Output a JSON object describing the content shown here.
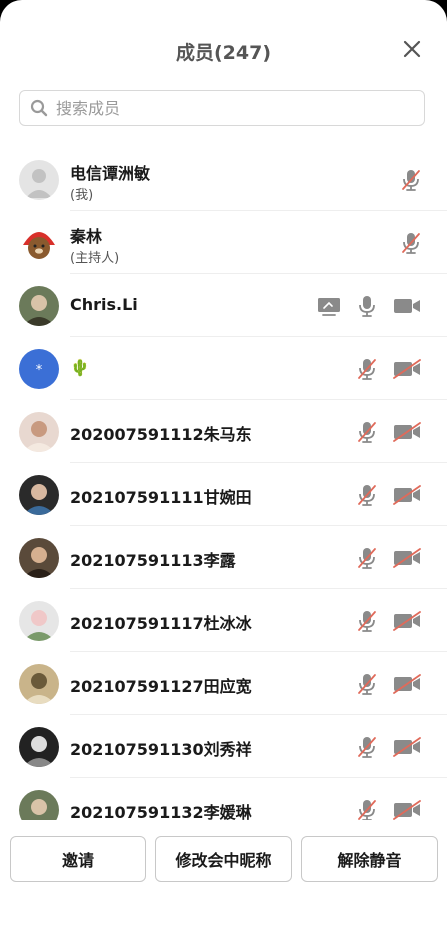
{
  "header": {
    "title": "成员(247)"
  },
  "search": {
    "placeholder": "搜索成员"
  },
  "members": [
    {
      "name": "电信谭洲敏",
      "sub": "(我)",
      "avatar": "default-avatar",
      "show_mic": true,
      "mic_muted": true,
      "show_screen": false,
      "show_camera": false,
      "camera_off": false
    },
    {
      "name": "秦林",
      "sub": "(主持人)",
      "avatar": "bear-avatar",
      "show_mic": true,
      "mic_muted": true,
      "show_screen": false,
      "show_camera": false,
      "camera_off": false
    },
    {
      "name": "Chris.Li",
      "sub": "",
      "avatar": "photo-avatar",
      "show_mic": true,
      "mic_muted": false,
      "show_screen": true,
      "show_camera": true,
      "camera_off": false
    },
    {
      "name": "🌵",
      "sub": "",
      "avatar": "star-avatar",
      "show_mic": true,
      "mic_muted": true,
      "show_screen": false,
      "show_camera": true,
      "camera_off": true
    },
    {
      "name": "202007591112朱马东",
      "sub": "",
      "avatar": "photo-avatar",
      "show_mic": true,
      "mic_muted": true,
      "show_screen": false,
      "show_camera": true,
      "camera_off": true
    },
    {
      "name": "202107591111甘婉田",
      "sub": "",
      "avatar": "photo-avatar",
      "show_mic": true,
      "mic_muted": true,
      "show_screen": false,
      "show_camera": true,
      "camera_off": true
    },
    {
      "name": "202107591113李露",
      "sub": "",
      "avatar": "photo-avatar",
      "show_mic": true,
      "mic_muted": true,
      "show_screen": false,
      "show_camera": true,
      "camera_off": true
    },
    {
      "name": "202107591117杜冰冰",
      "sub": "",
      "avatar": "photo-avatar",
      "show_mic": true,
      "mic_muted": true,
      "show_screen": false,
      "show_camera": true,
      "camera_off": true
    },
    {
      "name": "202107591127田应宽",
      "sub": "",
      "avatar": "photo-avatar",
      "show_mic": true,
      "mic_muted": true,
      "show_screen": false,
      "show_camera": true,
      "camera_off": true
    },
    {
      "name": "202107591130刘秀祥",
      "sub": "",
      "avatar": "photo-avatar",
      "show_mic": true,
      "mic_muted": true,
      "show_screen": false,
      "show_camera": true,
      "camera_off": true
    },
    {
      "name": "202107591132李媛琳",
      "sub": "",
      "avatar": "photo-avatar",
      "show_mic": true,
      "mic_muted": true,
      "show_screen": false,
      "show_camera": true,
      "camera_off": true
    }
  ],
  "footer": {
    "invite_label": "邀请",
    "rename_label": "修改会中昵称",
    "unmute_label": "解除静音"
  },
  "colors": {
    "icon_gray": "#8a8a8a",
    "muted_slash": "#e06a5a",
    "star_avatar_bg": "#3b6fd6",
    "cactus_green": "#3a9a3a"
  }
}
